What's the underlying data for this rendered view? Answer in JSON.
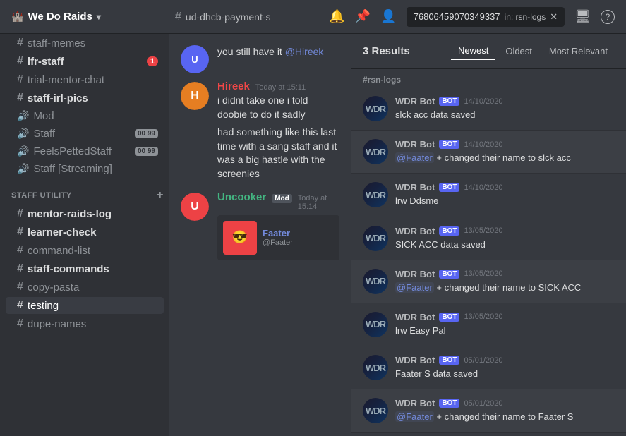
{
  "topbar": {
    "server_name": "We Do Raids",
    "chevron": "▾",
    "channel_name": "ud-dhcb-payment-s",
    "bell_icon": "🔔",
    "pin_icon": "📌",
    "members_icon": "👤",
    "search_value": "768064590703493​37",
    "search_in": "in: rsn-logs",
    "monitor_icon": "🖥",
    "help_icon": "?"
  },
  "sidebar": {
    "channels_top": [
      {
        "name": "staff-memes",
        "type": "text",
        "bold": false
      },
      {
        "name": "lfr-staff",
        "type": "text",
        "bold": true,
        "badge": "1"
      },
      {
        "name": "trial-mentor-chat",
        "type": "text",
        "bold": false
      },
      {
        "name": "staff-irl-pics",
        "type": "text",
        "bold": true
      },
      {
        "name": "Mod",
        "type": "voice",
        "bold": false
      },
      {
        "name": "Staff",
        "type": "voice",
        "bold": false,
        "muted": "00 99"
      },
      {
        "name": "FeelsPettedStaff",
        "type": "voice",
        "bold": false,
        "muted": "00 99"
      },
      {
        "name": "Staff [Streaming]",
        "type": "voice",
        "bold": false
      }
    ],
    "section_label": "STAFF UTILITY",
    "channels_bottom": [
      {
        "name": "mentor-raids-log",
        "type": "text",
        "bold": true
      },
      {
        "name": "learner-check",
        "type": "text",
        "bold": true
      },
      {
        "name": "command-list",
        "type": "text",
        "bold": false
      },
      {
        "name": "staff-commands",
        "type": "text",
        "bold": true
      },
      {
        "name": "copy-pasta",
        "type": "text",
        "bold": false
      },
      {
        "name": "testing",
        "type": "text",
        "bold": false,
        "active": true
      },
      {
        "name": "dupe-names",
        "type": "text",
        "bold": false
      }
    ]
  },
  "chat": {
    "channel_name": "ud-dhcb-payment-s",
    "messages": [
      {
        "id": "msg1",
        "partial_text": "you still have it @Hireek",
        "author": "",
        "time": "",
        "avatar_color": "",
        "is_partial": true
      },
      {
        "id": "msg2",
        "author": "Hireek",
        "author_color": "#f04747",
        "time": "Today at 15:11",
        "avatar_color": "#7289da",
        "text": "i didnt take one i told doobie to do it sadly"
      },
      {
        "id": "msg3",
        "author": "",
        "is_continuation": true,
        "text": "had something like this last time with a sang staff and it was a big hastle with the screenies"
      },
      {
        "id": "msg4",
        "author": "Uncooker [Mod]",
        "author_color": "#43b581",
        "time": "Today at 15:14",
        "avatar_color": "#ed4245",
        "is_mod": true,
        "has_preview": true,
        "preview_name": "Faater",
        "preview_label": "@Faater"
      }
    ]
  },
  "search": {
    "channel_label": "#rsn-logs",
    "results_count": "3 Results",
    "tabs": [
      {
        "label": "Newest",
        "active": true
      },
      {
        "label": "Oldest",
        "active": false
      },
      {
        "label": "Most Relevant",
        "active": false
      }
    ],
    "results": [
      {
        "id": "r1",
        "author": "WDR Bot",
        "is_bot": true,
        "date": "14/10/2020",
        "text": "slck acc data saved",
        "highlighted": false
      },
      {
        "id": "r2",
        "author": "WDR Bot",
        "is_bot": true,
        "date": "14/10/2020",
        "text_parts": [
          {
            "type": "mention",
            "value": "@Faater"
          },
          {
            "type": "plain",
            "value": " + changed their name to slck acc"
          }
        ],
        "highlighted": true
      },
      {
        "id": "r3",
        "author": "WDR Bot",
        "is_bot": true,
        "date": "14/10/2020",
        "text": "lrw Ddsme",
        "highlighted": false
      },
      {
        "id": "r4",
        "author": "WDR Bot",
        "is_bot": true,
        "date": "13/05/2020",
        "text": "SICK ACC data saved",
        "highlighted": false
      },
      {
        "id": "r5",
        "author": "WDR Bot",
        "is_bot": true,
        "date": "13/05/2020",
        "text_parts": [
          {
            "type": "mention",
            "value": "@Faater"
          },
          {
            "type": "plain",
            "value": " + changed their name to SICK ACC"
          }
        ],
        "highlighted": true
      },
      {
        "id": "r6",
        "author": "WDR Bot",
        "is_bot": true,
        "date": "13/05/2020",
        "text": "lrw Easy Pal",
        "highlighted": false
      },
      {
        "id": "r7",
        "author": "WDR Bot",
        "is_bot": true,
        "date": "05/01/2020",
        "text": "Faater S data saved",
        "highlighted": false
      },
      {
        "id": "r8",
        "author": "WDR Bot",
        "is_bot": true,
        "date": "05/01/2020",
        "text_parts": [
          {
            "type": "mention",
            "value": "@Faater"
          },
          {
            "type": "plain",
            "value": " + changed their name to Faater S"
          }
        ],
        "highlighted": true
      }
    ],
    "labels": {
      "results_count": "3 Results",
      "tab_newest": "Newest",
      "tab_oldest": "Oldest",
      "tab_most_relevant": "Most Relevant",
      "channel_label": "#rsn-logs",
      "bot_tag": "BOT",
      "wdr_bot_name": "WDR Bot"
    }
  }
}
